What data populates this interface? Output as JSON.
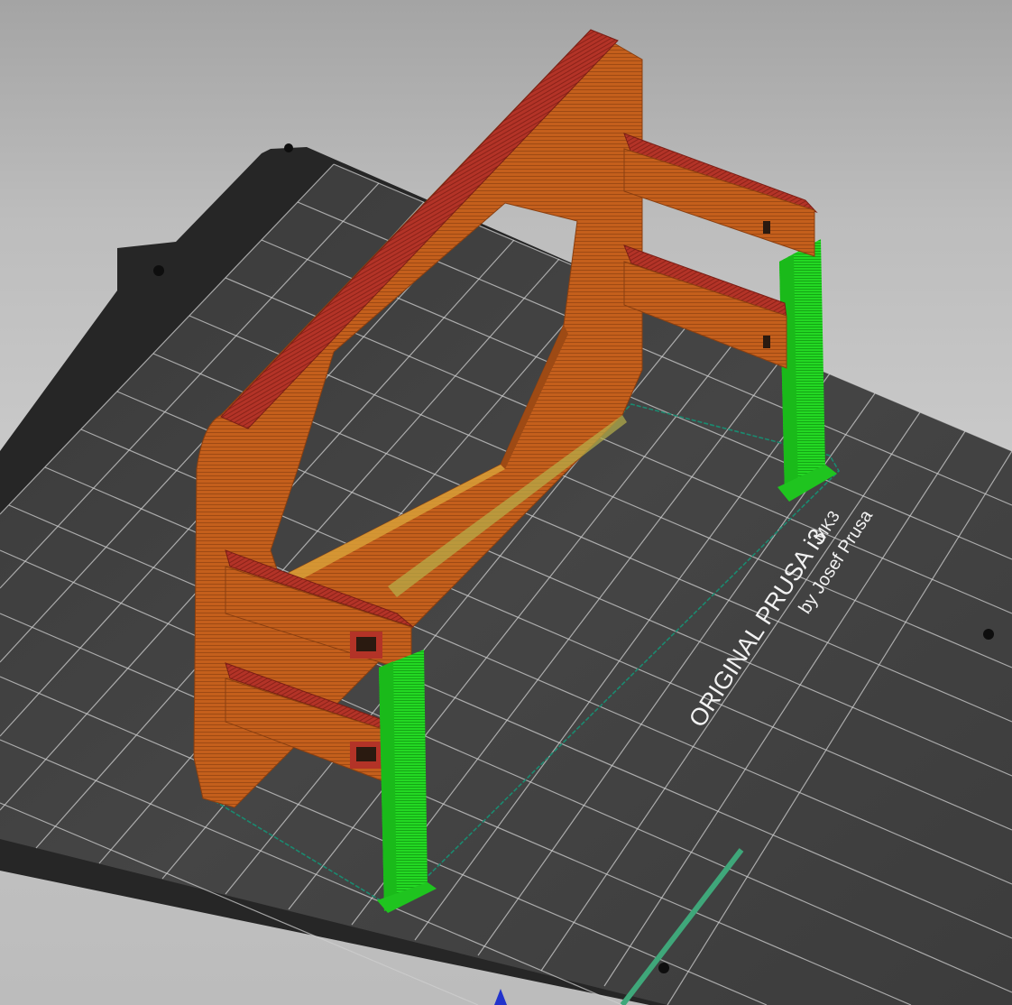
{
  "app": {
    "view": "3D print preview"
  },
  "bed": {
    "label_line1": "ORIGINAL PRUSA i3",
    "label_model": "MK3",
    "label_line2": "by Josef Prusa",
    "surface_color": "#2b2b2b",
    "grid_color": "#d9d9d9"
  },
  "model": {
    "frame_color": "#c2611d",
    "top_surface_color": "#a82f25",
    "support_color": "#1fd61f",
    "skirt_color": "#1a7a62"
  },
  "icons": {
    "axis_marker": "axis-arrow-icon"
  }
}
